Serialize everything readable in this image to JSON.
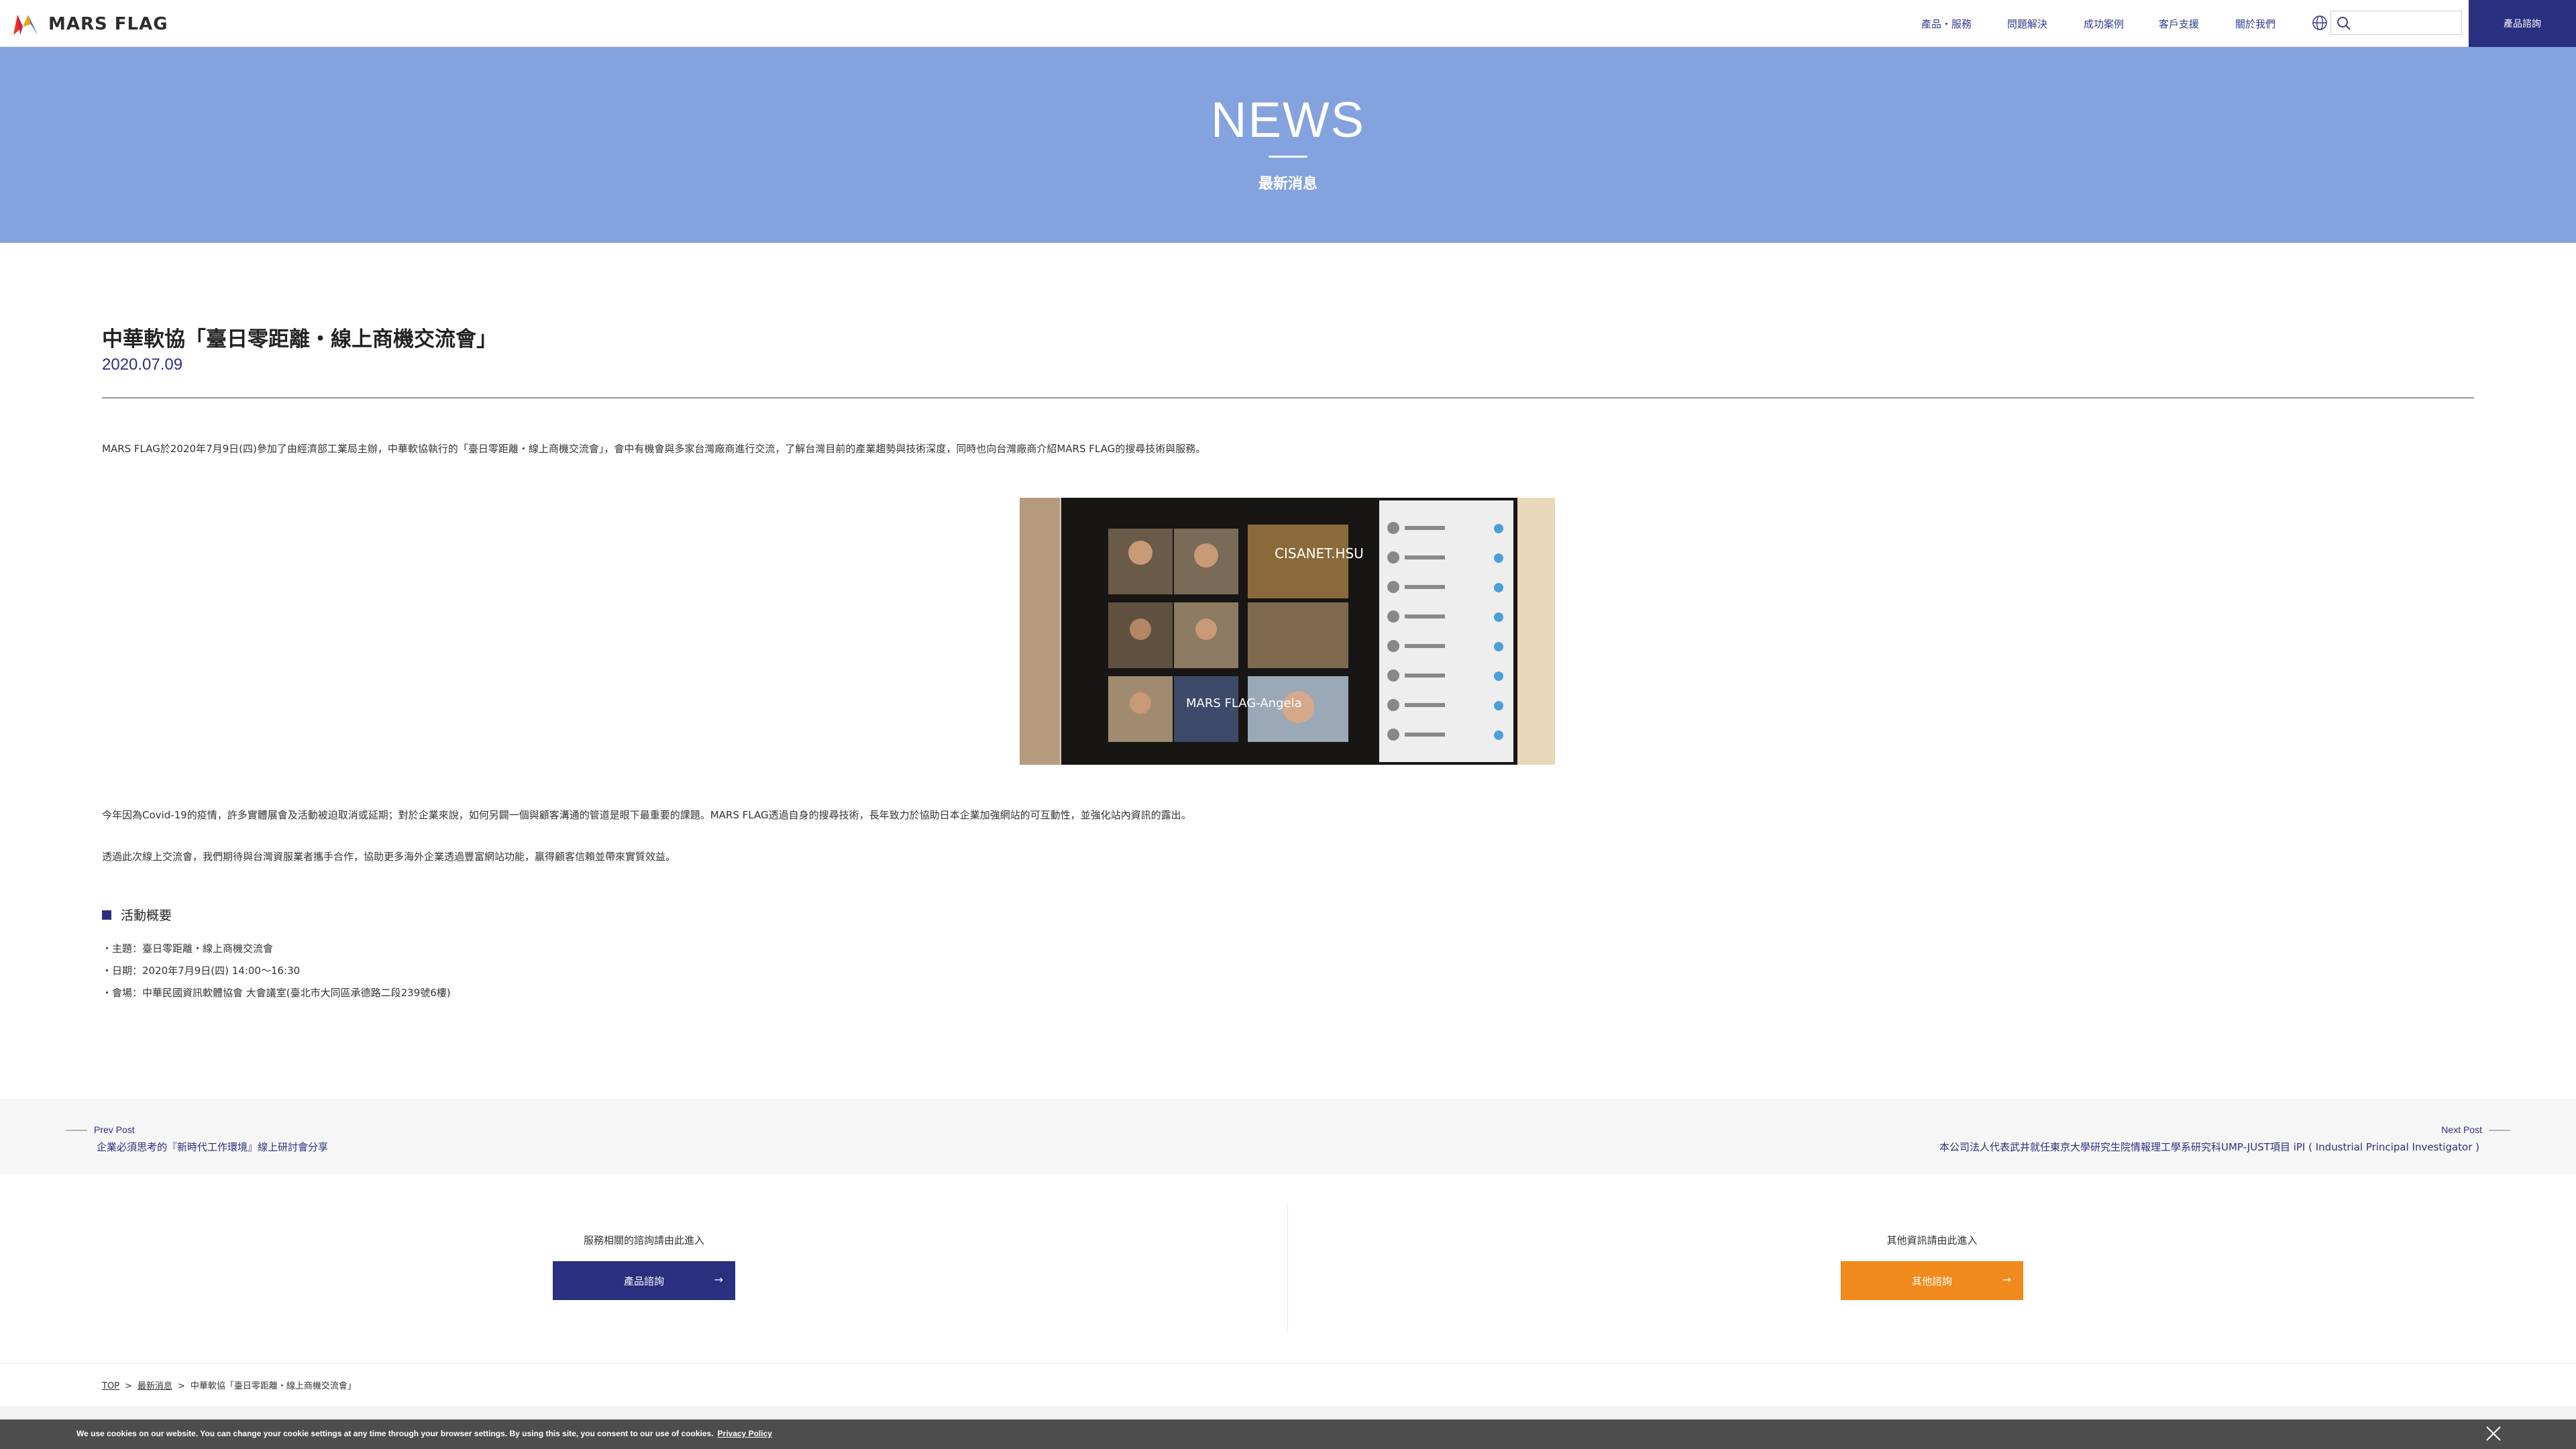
{
  "header": {
    "brand": "MARS FLAG",
    "nav": [
      "產品・服務",
      "問題解決",
      "成功案例",
      "客戶支援",
      "關於我們"
    ],
    "search_placeholder": "",
    "cta_label": "產品諮詢"
  },
  "hero": {
    "title": "NEWS",
    "subtitle": "最新消息"
  },
  "article": {
    "title": "中華軟協「臺日零距離・線上商機交流會」",
    "date": "2020.07.09",
    "intro": "MARS FLAG於2020年7月9日(四)參加了由經濟部工業局主辦，中華軟協執行的「臺日零距離・線上商機交流會」，會中有機會與多家台灣廠商進行交流，了解台灣目前的產業趨勢與技術深度，同時也向台灣廠商介紹MARS FLAG的搜尋技術與服務。",
    "para2": "今年因為Covid-19的疫情，許多實體展會及活動被迫取消或延期；對於企業來說，如何另闢一個與顧客溝通的管道是眼下最重要的課題。MARS FLAG透過自身的搜尋技術，長年致力於協助日本企業加強網站的可互動性，並強化站內資訊的露出。",
    "para3": "透過此次線上交流會，我們期待與台灣資服業者攜手合作，協助更多海外企業透過豐富網站功能，贏得顧客信賴並帶來實質效益。",
    "photo_labels": [
      "CISANET.HSU",
      "MARS FLAG-Angela"
    ],
    "section_heading": "活動概要",
    "details": [
      "・主題：臺日零距離・線上商機交流會",
      "・日期：2020年7月9日(四) 14:00〜16:30",
      "・會場：中華民國資訊軟體協會 大會議室(臺北市大同區承德路二段239號6樓)"
    ]
  },
  "pagenav": {
    "prev_label": "Prev Post",
    "prev_title": "企業必須思考的『新時代工作環境』線上研討會分享",
    "next_label": "Next Post",
    "next_title": "本公司法人代表武井就任東京大學研究生院情報理工學系研究科UMP-JUST項目 iPI ( Industrial Principal Investigator )"
  },
  "cta": {
    "left_text": "服務相關的諮詢請由此進入",
    "left_button": "產品諮詢",
    "right_text": "其他資訊請由此進入",
    "right_button": "其他諮詢"
  },
  "breadcrumb": [
    "TOP",
    "最新消息",
    "中華軟協「臺日零距離・線上商機交流會」"
  ],
  "cookie": {
    "text": "We use cookies on our website. You can change your cookie settings at any time through your browser settings. By using this site, you consent to our use of cookies.",
    "link": "Privacy Policy"
  },
  "colors": {
    "brand_navy": "#2b2f7f",
    "hero_blue": "#84a2de",
    "orange": "#f08a1c",
    "cookie_gray": "#4d4d4d"
  }
}
